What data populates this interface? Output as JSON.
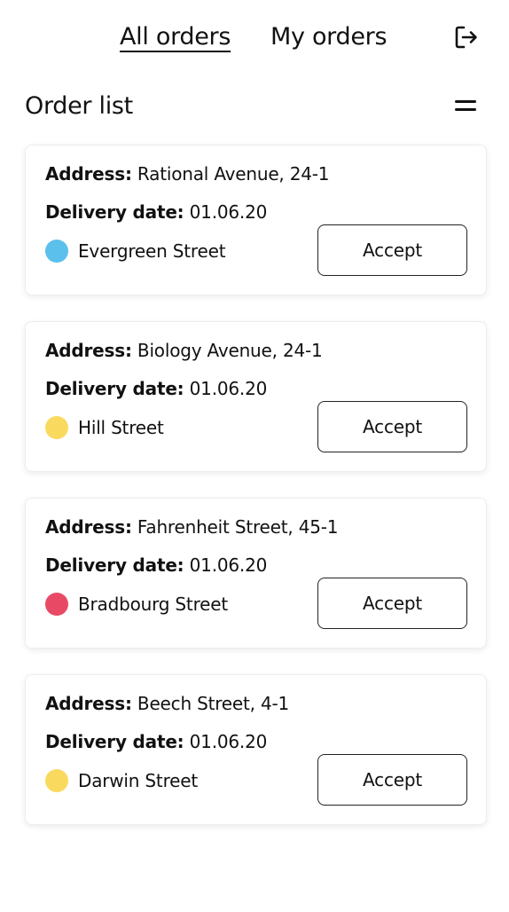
{
  "nav": {
    "tabs": [
      {
        "label": "All orders",
        "active": true
      },
      {
        "label": "My orders",
        "active": false
      }
    ],
    "logout_icon": "logout-icon"
  },
  "section": {
    "title": "Order list",
    "filter_icon": "equals-icon"
  },
  "orders": [
    {
      "address_label": "Address:",
      "address": "Rational Avenue, 24-1",
      "date_label": "Delivery date:",
      "date": "01.06.20",
      "route": "Evergreen Street",
      "route_color": "#5BC0EB",
      "action": "Accept"
    },
    {
      "address_label": "Address:",
      "address": "Biology Avenue, 24-1",
      "date_label": "Delivery date:",
      "date": "01.06.20",
      "route": "Hill Street",
      "route_color": "#FADA5E",
      "action": "Accept"
    },
    {
      "address_label": "Address:",
      "address": "Fahrenheit Street, 45-1",
      "date_label": "Delivery date:",
      "date": "01.06.20",
      "route": "Bradbourg Street",
      "route_color": "#E84A65",
      "action": "Accept"
    },
    {
      "address_label": "Address:",
      "address": "Beech Street, 4-1",
      "date_label": "Delivery date:",
      "date": "01.06.20",
      "route": "Darwin Street",
      "route_color": "#FADA5E",
      "action": "Accept"
    }
  ]
}
